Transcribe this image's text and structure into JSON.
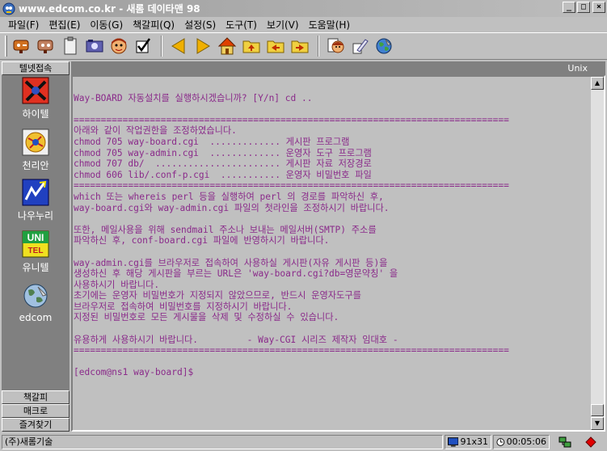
{
  "window": {
    "title": "www.edcom.co.kr - 새롬 데이타맨 98",
    "minimize": "_",
    "maximize": "□",
    "close": "×"
  },
  "menu": [
    "파일(F)",
    "편집(E)",
    "이동(G)",
    "책갈피(Q)",
    "설정(S)",
    "도구(T)",
    "보기(V)",
    "도움말(H)"
  ],
  "toolbar": {
    "icons": [
      "connect-icon",
      "disconnect-icon",
      "clipboard-icon",
      "capture-icon",
      "avatar-icon",
      "check-icon",
      "back-arrow-icon",
      "forward-arrow-icon",
      "home-icon",
      "up-folder-icon",
      "prev-folder-icon",
      "next-folder-icon",
      "help-person-icon",
      "edit-icon",
      "globe-icon"
    ]
  },
  "sidebar": {
    "top_tab": "텔넷접속",
    "shortcuts": [
      {
        "label": "하이텔",
        "icon": "hitel-icon"
      },
      {
        "label": "천리안",
        "icon": "chollian-icon"
      },
      {
        "label": "나우누리",
        "icon": "nownuri-icon"
      },
      {
        "label": "유니텔",
        "icon": "unitel-icon"
      },
      {
        "label": "edcom",
        "icon": "edcom-globe-icon"
      }
    ],
    "unitel_logo": [
      "UNI",
      "TEL"
    ],
    "bottom_tabs": [
      "책갈피",
      "매크로",
      "즐겨찾기"
    ]
  },
  "terminal": {
    "emulation": "Unix",
    "lines": [
      "",
      "Way-BOARD 자동설치를 실행하시겠습니까? [Y/n] cd ..",
      "",
      "================================================================================",
      "아래와 같이 작업권한을 조정하였습니다.",
      "chmod 705 way-board.cgi  ............. 게시판 프로그램",
      "chmod 705 way-admin.cgi  ............. 운영자 도구 프로그램",
      "chmod 707 db/  ....................... 게시판 자료 저장경로",
      "chmod 606 lib/.conf-p.cgi  ........... 운영자 비밀번호 파일",
      "================================================================================",
      "which 또는 whereis perl 등을 실행하여 perl 의 경로를 파악하신 후,",
      "way-board.cgi와 way-admin.cgi 파일의 첫라인을 조정하시기 바랍니다.",
      "",
      "또한, 메일사용을 위해 sendmail 주소나 보내는 메일서버(SMTP) 주소를",
      "파악하신 후, conf-board.cgi 파일에 반영하시기 바랍니다.",
      "",
      "way-admin.cgi를 브라우저로 접속하여 사용하실 게시판(자유 게시판 등)을",
      "생성하신 후 해당 게시판을 부르는 URL은 'way-board.cgi?db=영문약칭' 을",
      "사용하시기 바랍니다.",
      "초기에는 운영자 비밀번호가 지정되지 않았으므로, 반드시 운영자도구를",
      "브라우저로 접속하여 비밀번호를 지정하시기 바랍니다.",
      "지정된 비밀번호로 모든 게시물을 삭제 및 수정하실 수 있습니다.",
      "",
      "유용하게 사용하시기 바랍니다.         - Way-CGI 시리즈 제작자 임대호 -",
      "================================================================================",
      "",
      "[edcom@ns1 way-board]$"
    ]
  },
  "status": {
    "company": "(주)새롬기술",
    "size": "91x31",
    "timer": "00:05:06"
  }
}
